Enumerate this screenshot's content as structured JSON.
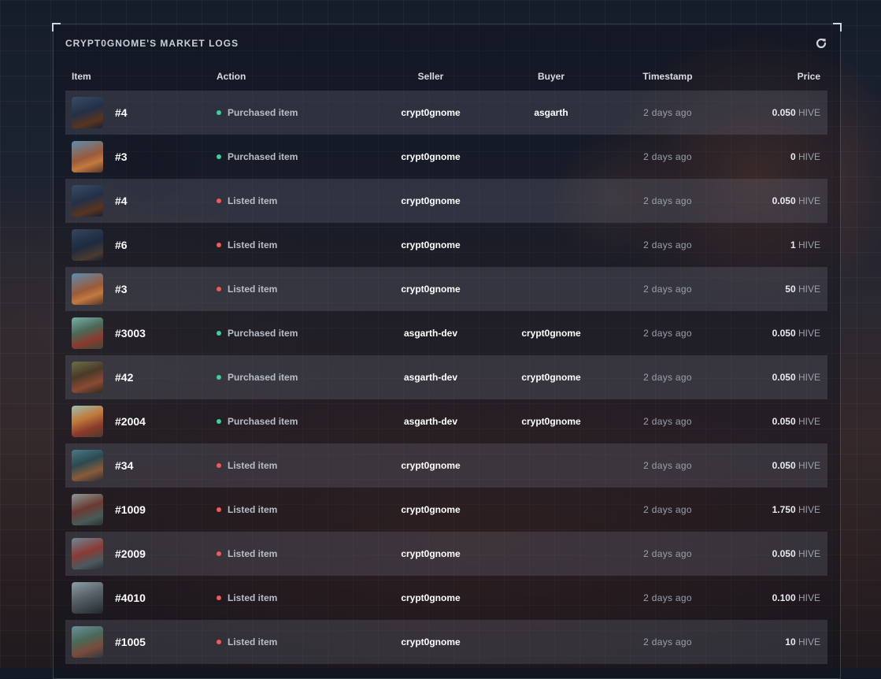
{
  "page": {
    "title": "CRYPT0GNOME'S MARKET LOGS",
    "refresh_icon": "refresh-icon"
  },
  "colors": {
    "purchased_dot": "#3ecf9a",
    "listed_dot": "#ef5a5a"
  },
  "table": {
    "headers": {
      "item": "Item",
      "action": "Action",
      "seller": "Seller",
      "buyer": "Buyer",
      "timestamp": "Timestamp",
      "price": "Price"
    },
    "rows": [
      {
        "item": "#4",
        "action": "Purchased item",
        "status": "purchased",
        "seller": "crypt0gnome",
        "buyer": "asgarth",
        "timestamp": "2 days ago",
        "price": "0.050",
        "currency": "HIVE"
      },
      {
        "item": "#3",
        "action": "Purchased item",
        "status": "purchased",
        "seller": "crypt0gnome",
        "buyer": "",
        "timestamp": "2 days ago",
        "price": "0",
        "currency": "HIVE"
      },
      {
        "item": "#4",
        "action": "Listed item",
        "status": "listed",
        "seller": "crypt0gnome",
        "buyer": "",
        "timestamp": "2 days ago",
        "price": "0.050",
        "currency": "HIVE"
      },
      {
        "item": "#6",
        "action": "Listed item",
        "status": "listed",
        "seller": "crypt0gnome",
        "buyer": "",
        "timestamp": "2 days ago",
        "price": "1",
        "currency": "HIVE"
      },
      {
        "item": "#3",
        "action": "Listed item",
        "status": "listed",
        "seller": "crypt0gnome",
        "buyer": "",
        "timestamp": "2 days ago",
        "price": "50",
        "currency": "HIVE"
      },
      {
        "item": "#3003",
        "action": "Purchased item",
        "status": "purchased",
        "seller": "asgarth-dev",
        "buyer": "crypt0gnome",
        "timestamp": "2 days ago",
        "price": "0.050",
        "currency": "HIVE"
      },
      {
        "item": "#42",
        "action": "Purchased item",
        "status": "purchased",
        "seller": "asgarth-dev",
        "buyer": "crypt0gnome",
        "timestamp": "2 days ago",
        "price": "0.050",
        "currency": "HIVE"
      },
      {
        "item": "#2004",
        "action": "Purchased item",
        "status": "purchased",
        "seller": "asgarth-dev",
        "buyer": "crypt0gnome",
        "timestamp": "2 days ago",
        "price": "0.050",
        "currency": "HIVE"
      },
      {
        "item": "#34",
        "action": "Listed item",
        "status": "listed",
        "seller": "crypt0gnome",
        "buyer": "",
        "timestamp": "2 days ago",
        "price": "0.050",
        "currency": "HIVE"
      },
      {
        "item": "#1009",
        "action": "Listed item",
        "status": "listed",
        "seller": "crypt0gnome",
        "buyer": "",
        "timestamp": "2 days ago",
        "price": "1.750",
        "currency": "HIVE"
      },
      {
        "item": "#2009",
        "action": "Listed item",
        "status": "listed",
        "seller": "crypt0gnome",
        "buyer": "",
        "timestamp": "2 days ago",
        "price": "0.050",
        "currency": "HIVE"
      },
      {
        "item": "#4010",
        "action": "Listed item",
        "status": "listed",
        "seller": "crypt0gnome",
        "buyer": "",
        "timestamp": "2 days ago",
        "price": "0.100",
        "currency": "HIVE"
      },
      {
        "item": "#1005",
        "action": "Listed item",
        "status": "listed",
        "seller": "crypt0gnome",
        "buyer": "",
        "timestamp": "2 days ago",
        "price": "10",
        "currency": "HIVE"
      }
    ]
  }
}
